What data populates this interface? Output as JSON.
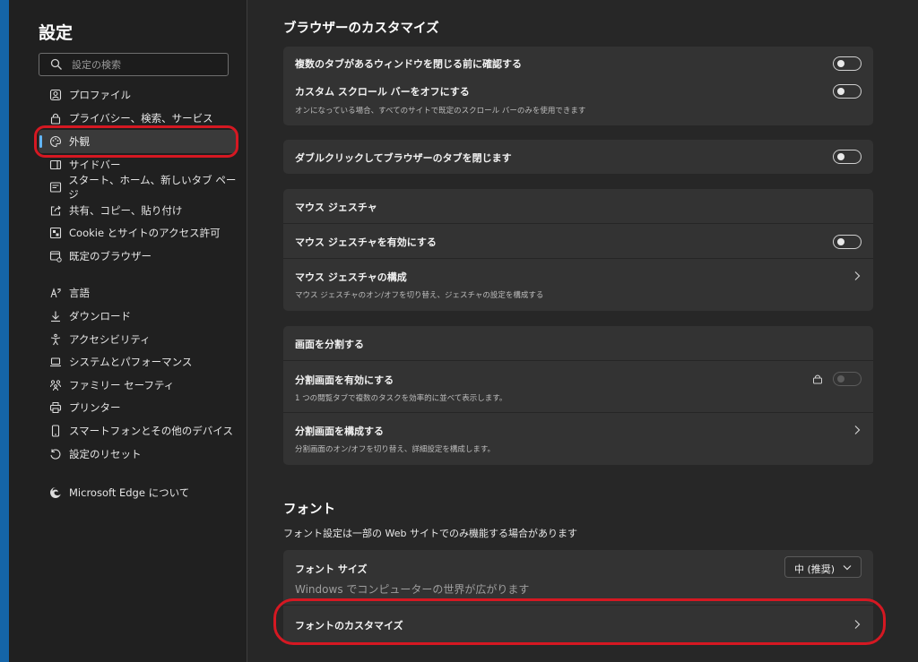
{
  "sidebar": {
    "title": "設定",
    "search_placeholder": "設定の検索",
    "items": [
      {
        "label": "プロファイル",
        "icon": "profile-icon"
      },
      {
        "label": "プライバシー、検索、サービス",
        "icon": "lock-icon"
      },
      {
        "label": "外観",
        "icon": "palette-icon",
        "active": true
      },
      {
        "label": "サイドバー",
        "icon": "sidebar-icon"
      },
      {
        "label": "スタート、ホーム、新しいタブ ページ",
        "icon": "home-icon"
      },
      {
        "label": "共有、コピー、貼り付け",
        "icon": "share-icon"
      },
      {
        "label": "Cookie とサイトのアクセス許可",
        "icon": "cookie-icon"
      },
      {
        "label": "既定のブラウザー",
        "icon": "browser-icon"
      },
      {
        "label": "言語",
        "icon": "language-icon"
      },
      {
        "label": "ダウンロード",
        "icon": "download-icon"
      },
      {
        "label": "アクセシビリティ",
        "icon": "accessibility-icon"
      },
      {
        "label": "システムとパフォーマンス",
        "icon": "laptop-icon"
      },
      {
        "label": "ファミリー セーフティ",
        "icon": "family-icon"
      },
      {
        "label": "プリンター",
        "icon": "printer-icon"
      },
      {
        "label": "スマートフォンとその他のデバイス",
        "icon": "phone-icon"
      },
      {
        "label": "設定のリセット",
        "icon": "reset-icon"
      },
      {
        "label": "Microsoft Edge について",
        "icon": "edge-icon"
      }
    ]
  },
  "main": {
    "browser_custom": {
      "title": "ブラウザーのカスタマイズ",
      "confirm_close_label": "複数のタブがあるウィンドウを閉じる前に確認する",
      "custom_scrollbar_label": "カスタム スクロール バーをオフにする",
      "custom_scrollbar_desc": "オンになっている場合、すべてのサイトで既定のスクロール バーのみを使用できます",
      "double_click_close_label": "ダブルクリックしてブラウザーのタブを閉じます"
    },
    "mouse_gesture": {
      "header": "マウス ジェスチャ",
      "enable_label": "マウス ジェスチャを有効にする",
      "config_label": "マウス ジェスチャの構成",
      "config_desc": "マウス ジェスチャのオン/オフを切り替え、ジェスチャの設定を構成する"
    },
    "split_screen": {
      "header": "画面を分割する",
      "enable_label": "分割画面を有効にする",
      "enable_desc": "1 つの閲覧タブで複数のタスクを効率的に並べて表示します。",
      "config_label": "分割画面を構成する",
      "config_desc": "分割画面のオン/オフを切り替え、詳細設定を構成します。"
    },
    "fonts": {
      "title": "フォント",
      "subtitle": "フォント設定は一部の Web サイトでのみ機能する場合があります",
      "font_size_label": "フォント サイズ",
      "font_size_value": "中 (推奨)",
      "font_size_preview": "Windows でコンピューターの世界が広がります",
      "customize_label": "フォントのカスタマイズ"
    }
  },
  "colors": {
    "accent": "#62b5f5",
    "highlight_oval": "#d51822",
    "edge_strip": "#1565a8"
  }
}
